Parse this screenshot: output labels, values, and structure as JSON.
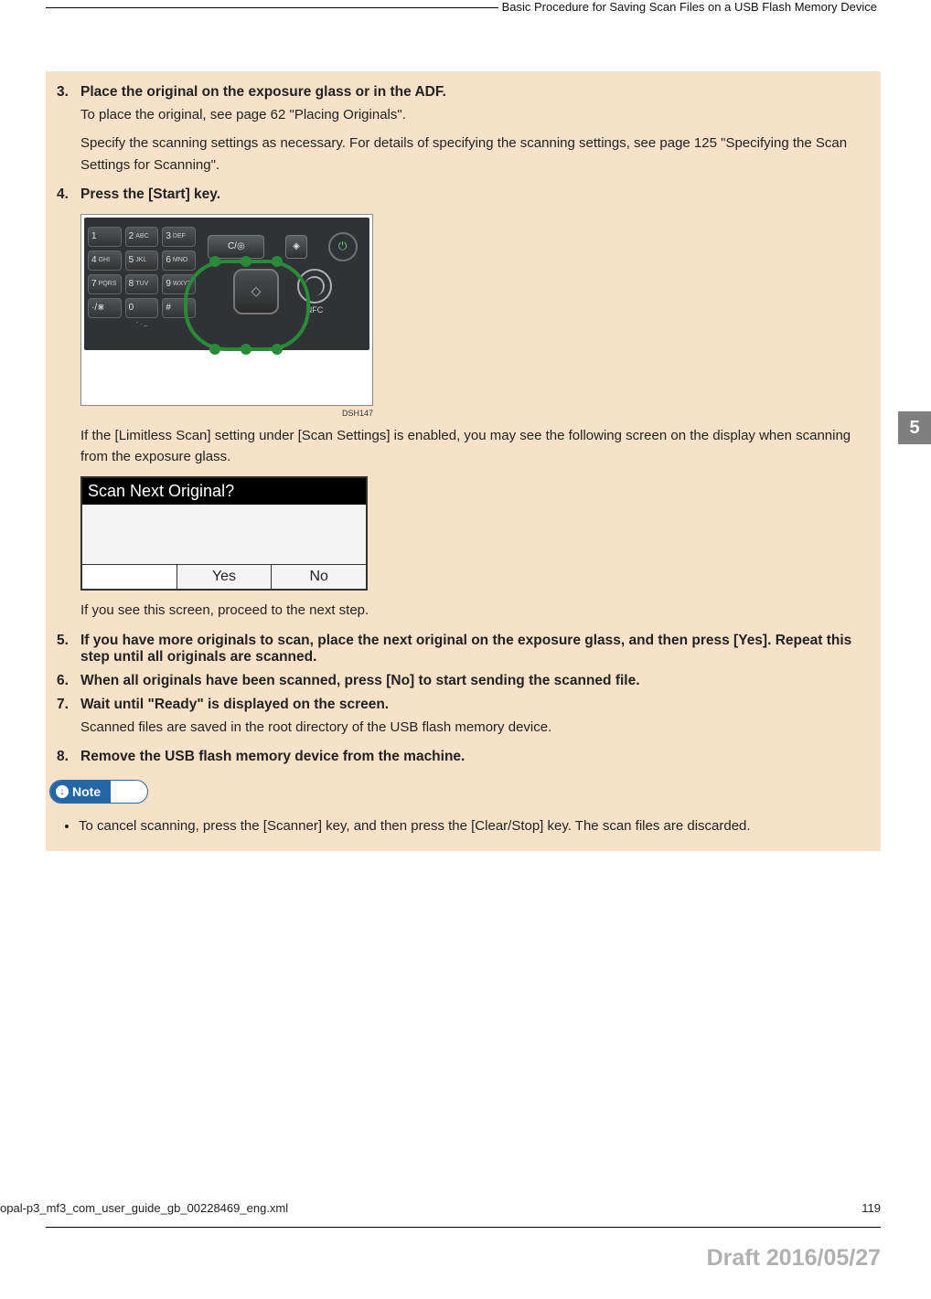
{
  "header": {
    "running_title": "Basic Procedure for Saving Scan Files on a USB Flash Memory Device"
  },
  "side_tab": "5",
  "steps": {
    "s3": {
      "num": "3.",
      "title": "Place the original on the exposure glass or in the ADF.",
      "para1": "To place the original, see page 62 \"Placing Originals\".",
      "para2": "Specify the scanning settings as necessary. For details of specifying the scanning settings, see page 125 \"Specifying the Scan Settings for Scanning\"."
    },
    "s4": {
      "num": "4.",
      "title": "Press the [Start] key.",
      "fig_code": "DSH147",
      "para_after_fig": "If the [Limitless Scan] setting under [Scan Settings] is enabled, you may see the following screen on the display when scanning from the exposure glass.",
      "para_after_lcd": "If you see this screen, proceed to the next step."
    },
    "s5": {
      "num": "5.",
      "title": "If you have more originals to scan, place the next original on the exposure glass, and then press [Yes]. Repeat this step until all originals are scanned."
    },
    "s6": {
      "num": "6.",
      "title": "When all originals have been scanned, press [No] to start sending the scanned file."
    },
    "s7": {
      "num": "7.",
      "title": "Wait until \"Ready\" is displayed on the screen.",
      "para": "Scanned files are saved in the root directory of the USB flash memory device."
    },
    "s8": {
      "num": "8.",
      "title": "Remove the USB flash memory device from the machine."
    }
  },
  "panel": {
    "keys": {
      "k1": "1",
      "k2": "2",
      "k2s": "ABC",
      "k3": "3",
      "k3s": "DEF",
      "k4": "4",
      "k4s": "GHI",
      "k5": "5",
      "k5s": "JKL",
      "k6": "6",
      "k6s": "MNO",
      "k7": "7",
      "k7s": "PQRS",
      "k8": "8",
      "k8s": "TUV",
      "k9": "9",
      "k9s": "WXYZ",
      "kstar": "·/⋇",
      "k0": "0",
      "khash": "#",
      "ksub": "- . _"
    },
    "clear_stop": "C/◎",
    "density_icon": "◈",
    "power_icon": "⏻",
    "start_icon": "◇",
    "nfc_label": "NFC"
  },
  "lcd": {
    "title": "Scan Next Original?",
    "yes": "Yes",
    "no": "No"
  },
  "note": {
    "label": "Note",
    "item": "To cancel scanning, press the [Scanner] key, and then press the [Clear/Stop] key. The scan files are discarded."
  },
  "footer": {
    "file_ref": "opal-p3_mf3_com_user_guide_gb_00228469_eng.xml",
    "page_num": "119",
    "draft": "Draft 2016/05/27"
  }
}
